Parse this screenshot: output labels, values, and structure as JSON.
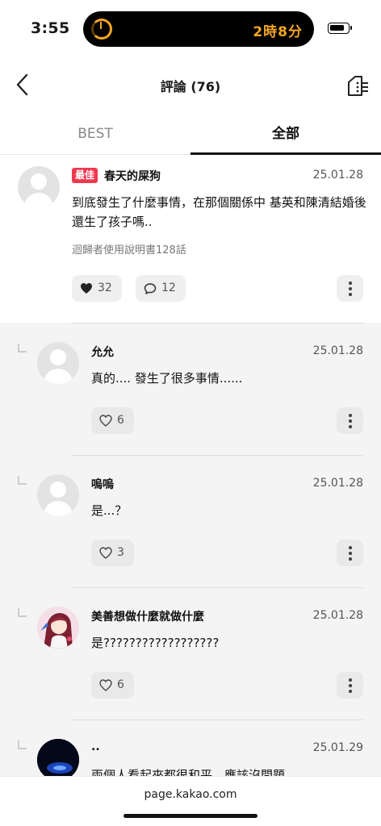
{
  "status": {
    "time": "3:55",
    "live_activity": "2時8分"
  },
  "header": {
    "title": "評論 (76)"
  },
  "tabs": [
    {
      "label": "BEST"
    },
    {
      "label": "全部"
    }
  ],
  "main_comment": {
    "badge": "最佳",
    "author": "春天的屎狗",
    "date": "25.01.28",
    "text": "到底發生了什麼事情，在那個關係中 基英和陳清結婚後還生了孩子嗎..",
    "meta": "迴歸者使用說明書128話",
    "likes": "32",
    "replies": "12"
  },
  "replies": [
    {
      "author": "允允",
      "date": "25.01.28",
      "text": "真的.... 發生了很多事情......",
      "likes": "6"
    },
    {
      "author": "嗚嗚",
      "date": "25.01.28",
      "text": "是...？",
      "likes": "3"
    },
    {
      "author": "美善想做什麼就做什麼",
      "date": "25.01.28",
      "text": "是??????????????????",
      "likes": "6"
    },
    {
      "author": "..",
      "date": "25.01.29",
      "text": "兩個人看起來都很和平，應該沒問題",
      "likes": ""
    }
  ],
  "url": "page.kakao.com",
  "icons": {
    "back": "chevron-left-icon",
    "list": "comment-list-icon",
    "heart": "heart-icon",
    "speech": "speech-bubble-icon",
    "more": "more-vertical-icon"
  }
}
